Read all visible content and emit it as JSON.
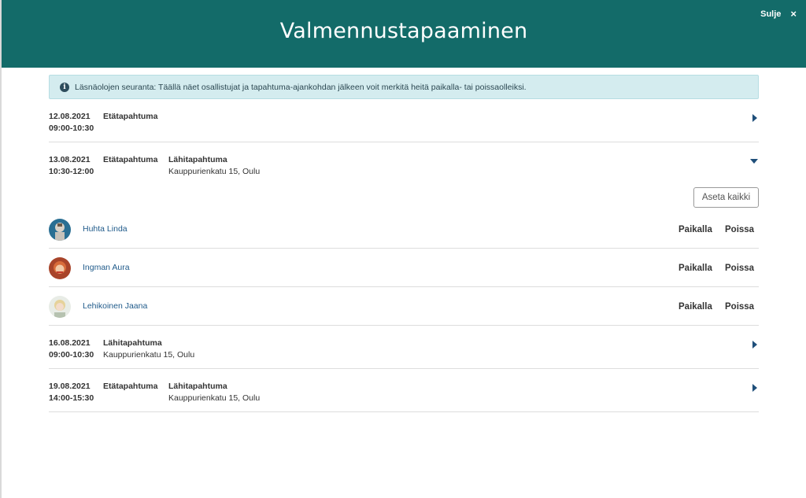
{
  "header": {
    "title": "Valmennustapaaminen",
    "close_label": "Sulje",
    "close_icon": "×"
  },
  "info": {
    "icon": "i",
    "text": "Läsnäolojen seuranta: Täällä näet osallistujat ja tapahtuma-ajankohdan jälkeen voit merkitä heitä paikalla- tai poissaolleiksi."
  },
  "events": [
    {
      "date": "12.08.2021",
      "time": "09:00-10:30",
      "type1": "Etätapahtuma",
      "type2": "",
      "address": "",
      "expanded": false
    },
    {
      "date": "13.08.2021",
      "time": "10:30-12:00",
      "type1": "Etätapahtuma",
      "type2": "Lähitapahtuma",
      "address": "Kauppurienkatu 15, Oulu",
      "expanded": true
    },
    {
      "date": "16.08.2021",
      "time": "09:00-10:30",
      "type1": "Lähitapahtuma",
      "type1_address": "Kauppurienkatu 15, Oulu",
      "expanded": false
    },
    {
      "date": "19.08.2021",
      "time": "14:00-15:30",
      "type1": "Etätapahtuma",
      "type2": "Lähitapahtuma",
      "address": "Kauppurienkatu 15, Oulu",
      "expanded": false
    }
  ],
  "attendance": {
    "set_all_label": "Aseta kaikki",
    "present_label": "Paikalla",
    "absent_label": "Poissa",
    "participants": [
      {
        "name": "Huhta Linda"
      },
      {
        "name": "Ingman Aura"
      },
      {
        "name": "Lehikoinen Jaana"
      }
    ]
  },
  "colors": {
    "header_bg": "#136b69",
    "info_bg": "#d4ecef",
    "link": "#1f5a8a",
    "caret": "#1f4f7a"
  }
}
